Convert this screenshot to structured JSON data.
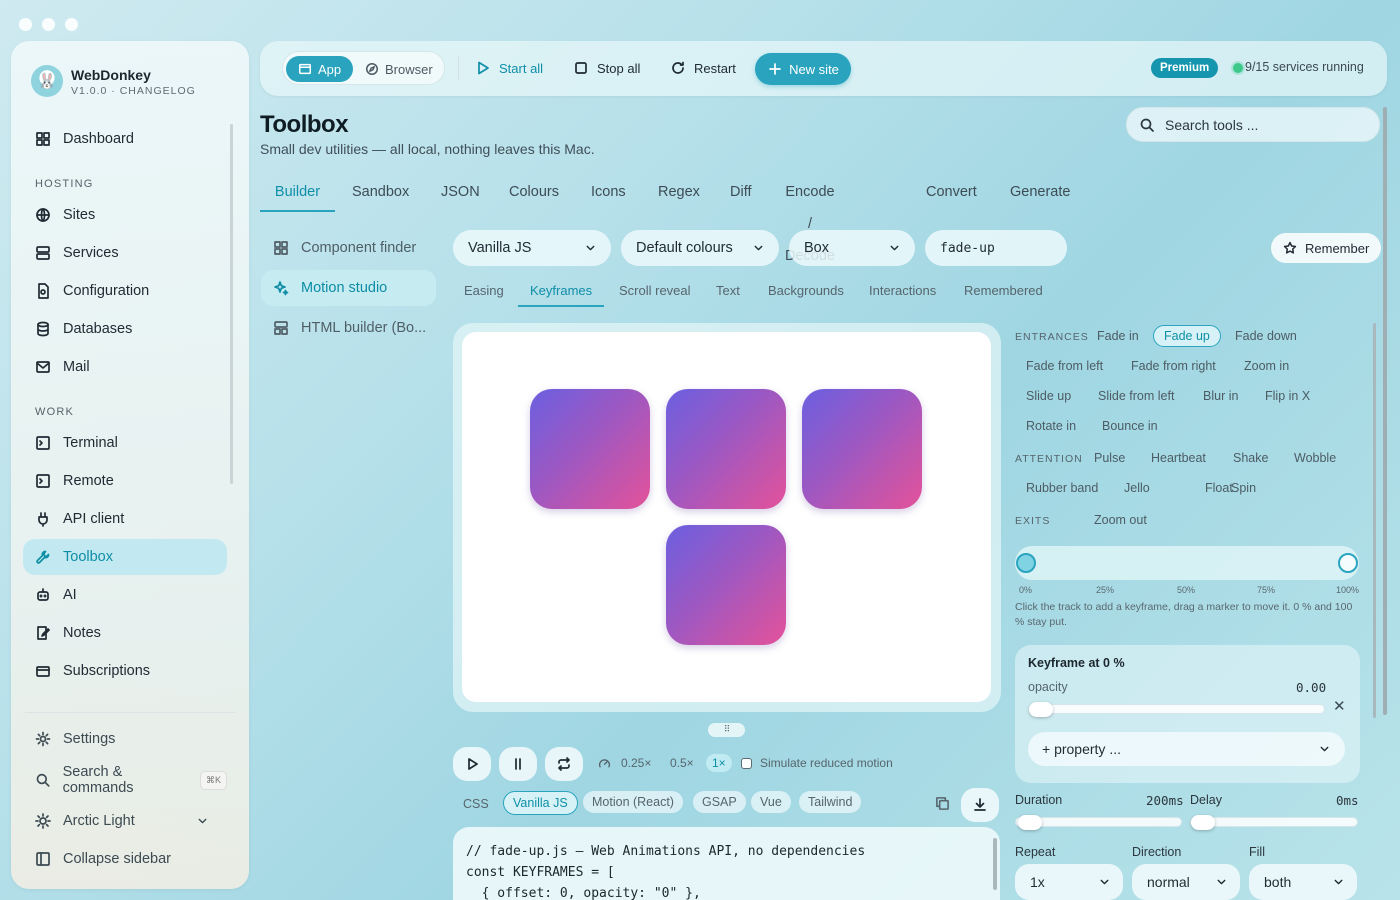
{
  "app": {
    "name": "WebDonkey",
    "version": "V1.0.0 · CHANGELOG"
  },
  "sidebar": {
    "dashboard": "Dashboard",
    "hosting_head": "HOSTING",
    "hosting": [
      "Sites",
      "Services",
      "Configuration",
      "Databases",
      "Mail"
    ],
    "work_head": "WORK",
    "work": [
      "Terminal",
      "Remote",
      "API client",
      "Toolbox",
      "AI",
      "Notes",
      "Subscriptions"
    ],
    "settings": "Settings",
    "search": "Search & commands",
    "search_kbd": "⌘K",
    "theme": "Arctic Light",
    "collapse": "Collapse sidebar"
  },
  "topbar": {
    "app_label": "App",
    "browser_label": "Browser",
    "start_all": "Start all",
    "stop_all": "Stop all",
    "restart": "Restart",
    "new_site": "New site",
    "premium": "Premium",
    "status": "9/15 services running"
  },
  "header": {
    "title": "Toolbox",
    "subtitle": "Small dev utilities — all local, nothing leaves this Mac.",
    "search_placeholder": "Search tools ..."
  },
  "tabs": [
    "Builder",
    "Sandbox",
    "JSON",
    "Colours",
    "Icons",
    "Regex",
    "Diff",
    "Encode / Decode",
    "Convert",
    "Generate"
  ],
  "subnav": [
    "Component finder",
    "Motion studio",
    "HTML builder (Bo..."
  ],
  "controls": {
    "framework": "Vanilla JS",
    "colours": "Default colours",
    "shape": "Box",
    "name": "fade-up",
    "remember": "Remember"
  },
  "motion_tabs": [
    "Easing",
    "Keyframes",
    "Scroll reveal",
    "Text",
    "Backgrounds",
    "Interactions",
    "Remembered"
  ],
  "playback": {
    "speeds": [
      "0.25×",
      "0.5×",
      "1×"
    ],
    "reduced_motion": "Simulate reduced motion"
  },
  "lang_tabs": [
    "CSS",
    "Vanilla JS",
    "Motion (React)",
    "GSAP",
    "Vue",
    "Tailwind"
  ],
  "code": "// fade-up.js — Web Animations API, no dependencies\nconst KEYFRAMES = [\n  { offset: 0, opacity: \"0\" },",
  "presets": {
    "entrances_head": "ENTRANCES",
    "entrances": [
      "Fade in",
      "Fade up",
      "Fade down",
      "Fade from left",
      "Fade from right",
      "Zoom in",
      "Slide up",
      "Slide from left",
      "Blur in",
      "Flip in X",
      "Rotate in",
      "Bounce in"
    ],
    "attention_head": "ATTENTION",
    "attention": [
      "Pulse",
      "Heartbeat",
      "Shake",
      "Wobble",
      "Rubber band",
      "Jello",
      "Float",
      "Spin"
    ],
    "exits_head": "EXITS",
    "exits": [
      "Zoom out"
    ],
    "selected": "Fade up"
  },
  "timeline": {
    "ticks": [
      "0%",
      "25%",
      "50%",
      "75%",
      "100%"
    ],
    "keyframes": [
      0,
      100
    ],
    "help": "Click the track to add a keyframe, drag a marker to move it. 0 % and 100 % stay put."
  },
  "keyframe": {
    "title": "Keyframe at 0 %",
    "prop": "opacity",
    "value": "0.00",
    "add_property": "+ property ..."
  },
  "timing": {
    "duration_label": "Duration",
    "duration": "200ms",
    "delay_label": "Delay",
    "delay": "0ms",
    "repeat_label": "Repeat",
    "repeat": "1x",
    "direction_label": "Direction",
    "direction": "normal",
    "fill_label": "Fill",
    "fill": "both"
  },
  "colors": {
    "accent": "#2aa3be",
    "status_ok": "#3cc98a"
  }
}
